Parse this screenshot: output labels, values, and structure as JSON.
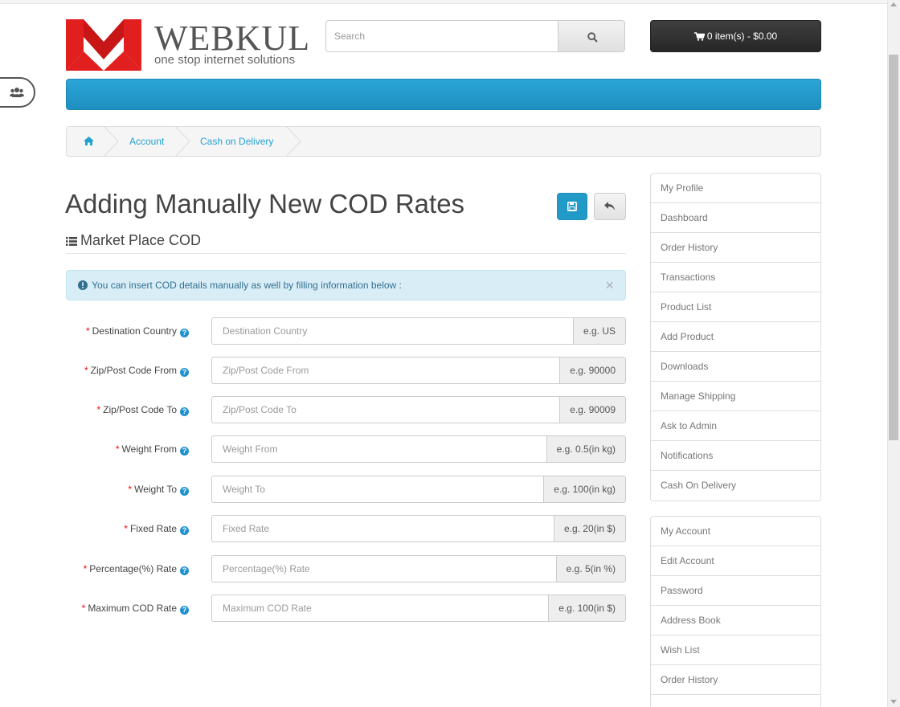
{
  "header": {
    "logo_name": "WEBKUL",
    "logo_tagline": "one stop internet solutions",
    "search_placeholder": "Search",
    "cart_label": "0 item(s) - $0.00"
  },
  "breadcrumb": {
    "items": [
      "Account",
      "Cash on Delivery"
    ]
  },
  "page": {
    "title": "Adding Manually New COD Rates",
    "subtitle": "Market Place COD"
  },
  "alert": {
    "text": "You can insert COD details manually as well by filling information below :",
    "close": "×"
  },
  "form": {
    "required_mark": "*",
    "help_glyph": "?",
    "fields": [
      {
        "label": "Destination Country",
        "placeholder": "Destination Country",
        "hint": "e.g. US"
      },
      {
        "label": "Zip/Post Code From",
        "placeholder": "Zip/Post Code From",
        "hint": "e.g. 90000"
      },
      {
        "label": "Zip/Post Code To",
        "placeholder": "Zip/Post Code To",
        "hint": "e.g. 90009"
      },
      {
        "label": "Weight From",
        "placeholder": "Weight From",
        "hint": "e.g. 0.5(in kg)"
      },
      {
        "label": "Weight To",
        "placeholder": "Weight To",
        "hint": "e.g. 100(in kg)"
      },
      {
        "label": "Fixed Rate",
        "placeholder": "Fixed Rate",
        "hint": "e.g. 20(in $)"
      },
      {
        "label": "Percentage(%) Rate",
        "placeholder": "Percentage(%) Rate",
        "hint": "e.g. 5(in %)"
      },
      {
        "label": "Maximum COD Rate",
        "placeholder": "Maximum COD Rate",
        "hint": "e.g. 100(in $)"
      }
    ]
  },
  "sidebar": {
    "seller_menu": [
      "My Profile",
      "Dashboard",
      "Order History",
      "Transactions",
      "Product List",
      "Add Product",
      "Downloads",
      "Manage Shipping",
      "Ask to Admin",
      "Notifications",
      "Cash On Delivery"
    ],
    "account_menu": [
      "My Account",
      "Edit Account",
      "Password",
      "Address Book",
      "Wish List",
      "Order History"
    ]
  },
  "colors": {
    "nav": "#229ac8",
    "link": "#23a1d1",
    "required": "#ff0000",
    "alert_bg": "#d9edf7"
  },
  "icons": [
    "users-icon",
    "search-icon",
    "cart-icon",
    "home-icon",
    "save-icon",
    "reply-icon",
    "list-icon",
    "info-circle-icon",
    "close-icon",
    "help-icon"
  ]
}
